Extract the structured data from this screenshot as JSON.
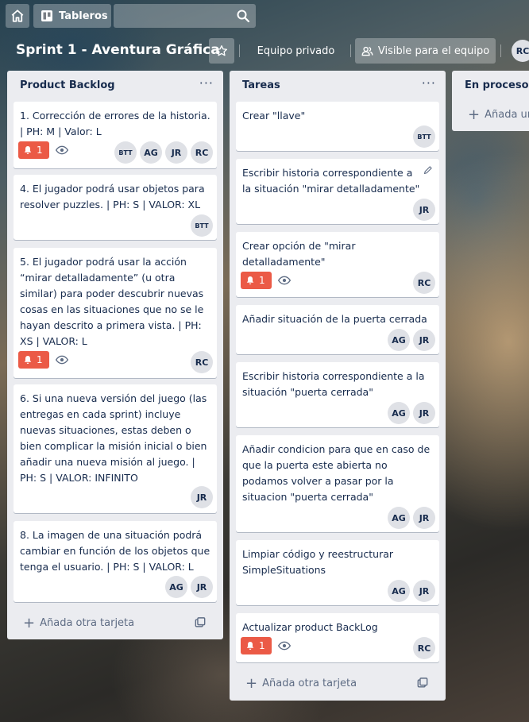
{
  "topbar": {
    "boards_label": "Tableros"
  },
  "board": {
    "title": "Sprint 1 - Aventura Gráfica",
    "team_label": "Equipo privado",
    "visibility_label": "Visible para el equipo",
    "avatar": "RC"
  },
  "lists": [
    {
      "title": "Product Backlog",
      "add_label": "Añada otra tarjeta",
      "cards": [
        {
          "text": "1. Corrección de errores de la historia. | PH: M | Valor: L",
          "due": "1",
          "watch": true,
          "members": [
            "BTT",
            "AG",
            "JR",
            "RC"
          ]
        },
        {
          "text": "4. El jugador podrá usar objetos para resolver puzzles. | PH: S | VALOR: XL",
          "members": [
            "BTT"
          ]
        },
        {
          "text": "5. El jugador podrá usar la acción “mirar detalladamente” (u otra similar) para poder descubrir nuevas cosas en las situaciones que no se le hayan descrito a primera vista. | PH: XS | VALOR: L",
          "due": "1",
          "watch": true,
          "members": [
            "RC"
          ]
        },
        {
          "text": "6. Si una nueva versión del juego (las entregas en cada sprint) incluye nuevas situaciones, estas deben o bien complicar la misión inicial o bien añadir una nueva misión al juego. | PH: S | VALOR: INFINITO",
          "members": [
            "JR"
          ]
        },
        {
          "text": "8. La imagen de una situación podrá cambiar en función de los objetos que tenga el usuario. | PH: S | VALOR: L",
          "members": [
            "AG",
            "JR"
          ]
        }
      ]
    },
    {
      "title": "Tareas",
      "add_label": "Añada otra tarjeta",
      "cards": [
        {
          "text": "Crear \"llave\"",
          "members": [
            "BTT"
          ]
        },
        {
          "text": "Escribir historia correspondiente a la situación \"mirar detalladamente\"",
          "members": [
            "JR"
          ]
        },
        {
          "text": "Crear opción de \"mirar detalladamente\"",
          "due": "1",
          "watch": true,
          "members": [
            "RC"
          ]
        },
        {
          "text": "Añadir situación de la puerta cerrada",
          "members": [
            "AG",
            "JR"
          ]
        },
        {
          "text": "Escribir historia correspondiente a la situación \"puerta cerrada\"",
          "members": [
            "AG",
            "JR"
          ]
        },
        {
          "text": "Añadir condicion para que en caso de que la puerta este abierta no podamos volver a pasar por la situacion \"puerta cerrada\"",
          "members": [
            "AG",
            "JR"
          ]
        },
        {
          "text": "Limpiar código y reestructurar SimpleSituations",
          "members": [
            "AG",
            "JR"
          ]
        },
        {
          "text": "Actualizar product BackLog",
          "due": "1",
          "watch": true,
          "members": [
            "RC"
          ]
        }
      ]
    },
    {
      "title": "En proceso",
      "add_label": "Añada una tarjeta"
    }
  ]
}
